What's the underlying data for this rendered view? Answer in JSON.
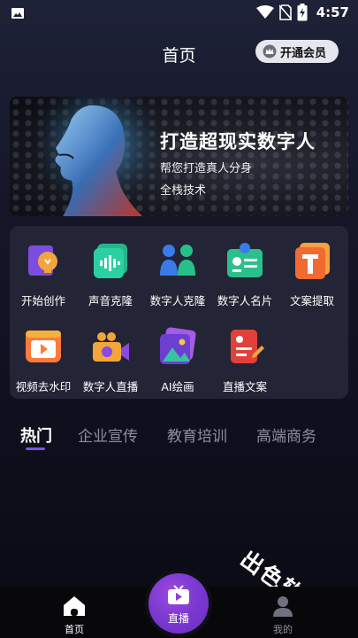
{
  "status": {
    "time": "4:57"
  },
  "header": {
    "title": "首页",
    "vip_label": "开通会员"
  },
  "banner": {
    "headline": "打造超现实数字人",
    "sub1": "帮您打造真人分身",
    "sub2": "全栈技术"
  },
  "tools": [
    {
      "label": "开始创作",
      "icon": "lightbulb-doc-icon"
    },
    {
      "label": "声音克隆",
      "icon": "sound-wave-icon"
    },
    {
      "label": "数字人克隆",
      "icon": "people-clone-icon"
    },
    {
      "label": "数字人名片",
      "icon": "id-card-icon"
    },
    {
      "label": "文案提取",
      "icon": "text-extract-icon"
    },
    {
      "label": "视频去水印",
      "icon": "video-play-icon"
    },
    {
      "label": "数字人直播",
      "icon": "camera-live-icon"
    },
    {
      "label": "AI绘画",
      "icon": "ai-picture-icon"
    },
    {
      "label": "直播文案",
      "icon": "document-pen-icon"
    }
  ],
  "tabs": [
    "热门",
    "企业宣传",
    "教育培训",
    "高端商务"
  ],
  "active_tab": "热门",
  "bottom_nav": {
    "home": "首页",
    "live": "直播",
    "mine": "我的"
  },
  "watermark": "出色软件站",
  "colors": {
    "accent": "#7b55d8",
    "live_button": "#8a3fd8"
  }
}
